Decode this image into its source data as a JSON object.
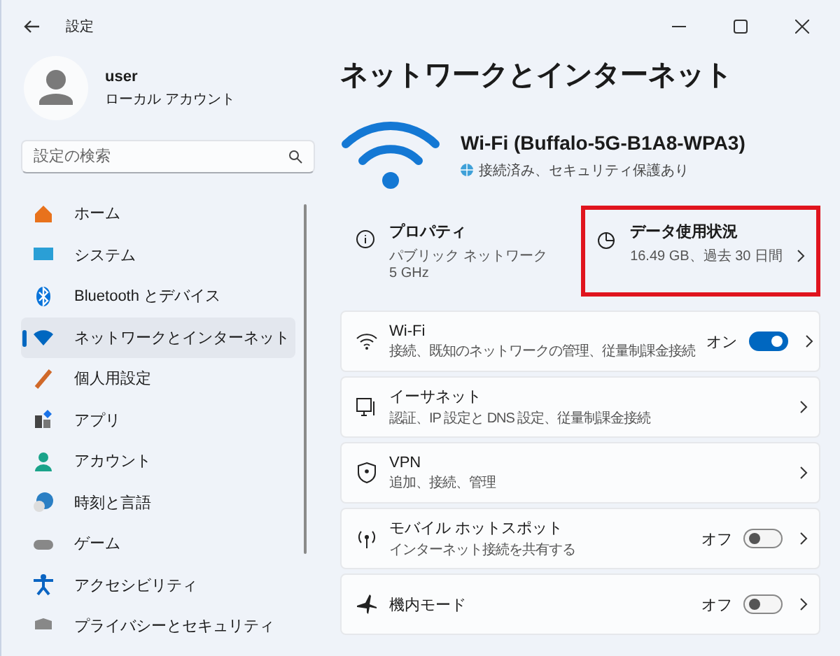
{
  "window": {
    "title": "設定"
  },
  "user": {
    "name": "user",
    "account_type": "ローカル アカウント"
  },
  "search": {
    "placeholder": "設定の検索"
  },
  "sidebar": {
    "items": [
      {
        "label": "ホーム",
        "selected": false
      },
      {
        "label": "システム",
        "selected": false
      },
      {
        "label": "Bluetooth とデバイス",
        "selected": false
      },
      {
        "label": "ネットワークとインターネット",
        "selected": true
      },
      {
        "label": "個人用設定",
        "selected": false
      },
      {
        "label": "アプリ",
        "selected": false
      },
      {
        "label": "アカウント",
        "selected": false
      },
      {
        "label": "時刻と言語",
        "selected": false
      },
      {
        "label": "ゲーム",
        "selected": false
      },
      {
        "label": "アクセシビリティ",
        "selected": false
      },
      {
        "label": "プライバシーとセキュリティ",
        "selected": false
      }
    ]
  },
  "page_title": "ネットワークとインターネット",
  "connection": {
    "name": "Wi-Fi (Buffalo-5G-B1A8-WPA3)",
    "status": "接続済み、セキュリティ保護あり"
  },
  "summary_tiles": [
    {
      "kind": "properties",
      "title": "プロパティ",
      "lines": [
        "パブリック ネットワーク",
        "5 GHz"
      ],
      "highlighted": false
    },
    {
      "kind": "data",
      "title": "データ使用状況",
      "lines": [
        "16.49 GB、過去 30 日間"
      ],
      "highlighted": true
    }
  ],
  "settings": [
    {
      "kind": "toggle",
      "title": "Wi-Fi",
      "subtitle": "接続、既知のネットワークの管理、従量制課金接続",
      "state_label": "オン",
      "on": true
    },
    {
      "kind": "link",
      "title": "イーサネット",
      "subtitle": "認証、IP 設定と DNS 設定、従量制課金接続"
    },
    {
      "kind": "link",
      "title": "VPN",
      "subtitle": "追加、接続、管理"
    },
    {
      "kind": "toggle",
      "title": "モバイル ホットスポット",
      "subtitle": "インターネット接続を共有する",
      "state_label": "オフ",
      "on": false
    },
    {
      "kind": "toggle",
      "title": "機内モード",
      "state_label": "オフ",
      "on": false
    }
  ]
}
